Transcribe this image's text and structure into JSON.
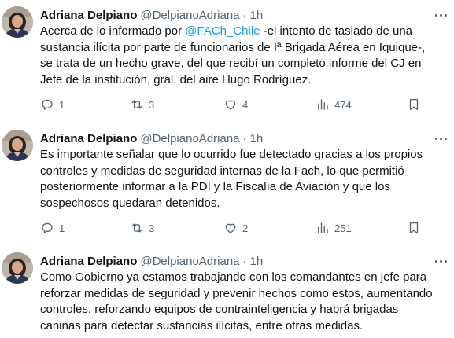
{
  "author": {
    "name": "Adriana Delpiano",
    "handle": "@DelpianoAdriana",
    "separator": "·"
  },
  "tweets": [
    {
      "time": "1h",
      "lines": [
        [
          "Acerca de lo informado por ",
          "@FACh_Chile",
          " -el intento de taslado de una"
        ],
        [
          "sustancia ilícita por parte de funcionarios de Iª Brigada Aérea en Iquique-,"
        ],
        [
          "se trata de un hecho grave, del que recibí un completo informe del CJ en"
        ],
        [
          "Jefe de la institución, gral. del aire Hugo Rodríguez."
        ]
      ],
      "replies": "1",
      "retweets": "3",
      "likes": "4",
      "views": "474"
    },
    {
      "time": "1h",
      "lines": [
        [
          "Es importante señalar que lo ocurrido fue detectado gracias a los propios"
        ],
        [
          "controles y medidas de seguridad internas de la Fach, lo que permitió"
        ],
        [
          "posteriormente informar a la PDI y la Fiscalía de Aviación y que los"
        ],
        [
          "sospechosos quedaran detenidos."
        ]
      ],
      "replies": "1",
      "retweets": "3",
      "likes": "2",
      "views": "251"
    },
    {
      "time": "1h",
      "lines": [
        [
          "Como Gobierno ya estamos trabajando con los comandantes en jefe para"
        ],
        [
          "reforzar medidas de seguridad y prevenir hechos como estos, aumentando"
        ],
        [
          "controles, reforzando equipos de contrainteligencia y habrá brigadas"
        ],
        [
          "caninas para detectar sustancias ilícitas, entre otras medidas."
        ]
      ]
    }
  ],
  "icons": {
    "reply": "reply-icon",
    "retweet": "retweet-icon",
    "like": "heart-icon",
    "views": "views-icon",
    "bookmark": "bookmark-icon",
    "more": "more-icon"
  },
  "colors": {
    "text": "#0f1419",
    "secondary": "#536471",
    "mention": "#1d9bf0",
    "background": "#ffffff"
  }
}
